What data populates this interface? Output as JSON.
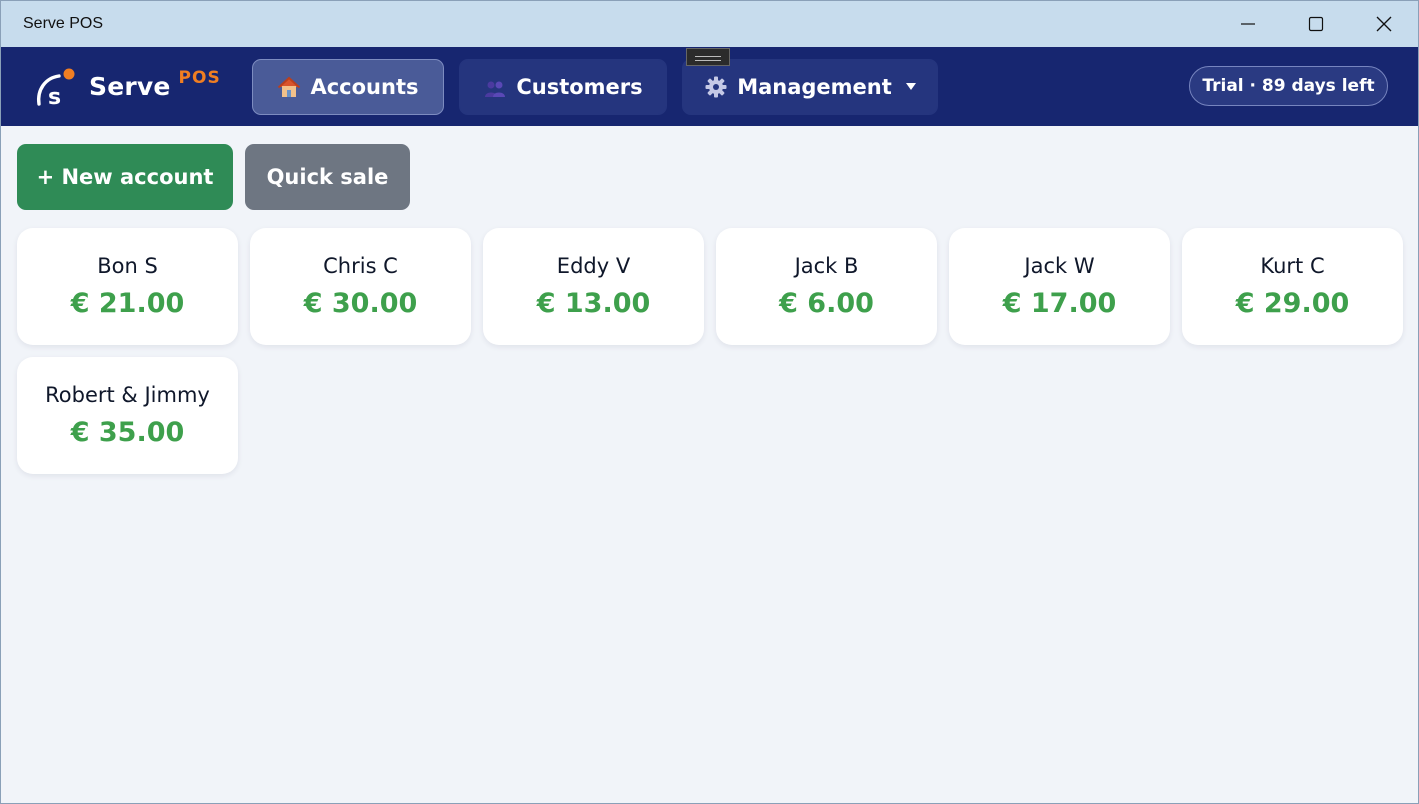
{
  "window": {
    "title": "Serve POS"
  },
  "brand": {
    "name": "Serve",
    "sub": "POS",
    "accent": "#f07e22"
  },
  "nav": {
    "tabs": [
      {
        "label": "Accounts",
        "icon": "house-icon",
        "active": true
      },
      {
        "label": "Customers",
        "icon": "people-icon",
        "active": false
      },
      {
        "label": "Management",
        "icon": "gear-icon",
        "active": false,
        "dropdown": true
      }
    ]
  },
  "trial": {
    "label": "Trial · 89 days left"
  },
  "actions": {
    "new_account": "+ New account",
    "quick_sale": "Quick sale"
  },
  "accounts": [
    {
      "name": "Bon S",
      "amount": "€ 21.00"
    },
    {
      "name": "Chris C",
      "amount": "€ 30.00"
    },
    {
      "name": "Eddy V",
      "amount": "€ 13.00"
    },
    {
      "name": "Jack B",
      "amount": "€ 6.00"
    },
    {
      "name": "Jack W",
      "amount": "€ 17.00"
    },
    {
      "name": "Kurt C",
      "amount": "€ 29.00"
    },
    {
      "name": "Robert & Jimmy",
      "amount": "€ 35.00"
    }
  ],
  "colors": {
    "header": "#172670",
    "new_button": "#2f8b56",
    "quick_button": "#6e7682",
    "amount": "#3ea04c"
  }
}
